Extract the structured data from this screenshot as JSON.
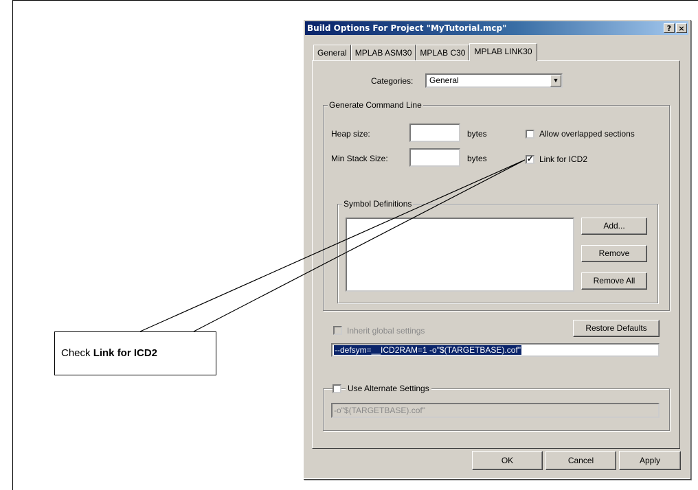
{
  "dialog": {
    "title": "Build Options For Project \"MyTutorial.mcp\"",
    "help_label": "?",
    "close_label": "×"
  },
  "tabs": [
    {
      "label": "General"
    },
    {
      "label": "MPLAB ASM30"
    },
    {
      "label": "MPLAB C30"
    },
    {
      "label": "MPLAB LINK30",
      "active": true
    }
  ],
  "categories": {
    "label": "Categories:",
    "value": "General"
  },
  "generate_group": {
    "title": "Generate Command Line",
    "heap_label": "Heap size:",
    "heap_unit": "bytes",
    "stack_label": "Min Stack Size:",
    "stack_unit": "bytes",
    "allow_overlap_label": "Allow overlapped sections",
    "allow_overlap_checked": false,
    "link_icd2_label": "Link for ICD2",
    "link_icd2_checked": true
  },
  "symbol_group": {
    "title": "Symbol Definitions",
    "add_label": "Add...",
    "remove_label": "Remove",
    "remove_all_label": "Remove All"
  },
  "inherit_label": "Inherit global settings",
  "restore_label": "Restore Defaults",
  "command_line": "--defsym=__ICD2RAM=1 -o\"$(TARGETBASE).cof\"",
  "alternate": {
    "label": "Use Alternate Settings",
    "value": "-o\"$(TARGETBASE).cof\""
  },
  "footer": {
    "ok_label": "OK",
    "cancel_label": "Cancel",
    "apply_label": "Apply"
  },
  "callout": {
    "prefix": "Check ",
    "bold": "Link for ICD2"
  }
}
